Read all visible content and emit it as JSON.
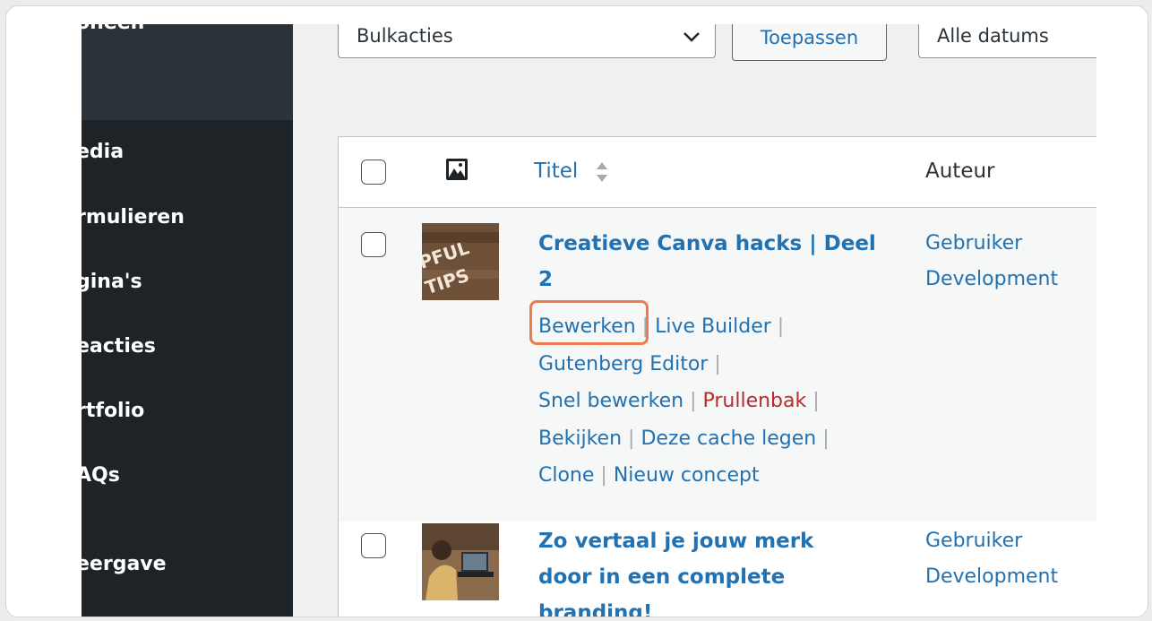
{
  "sidebar": {
    "top_partial": "oneen",
    "items": [
      {
        "label": "edia"
      },
      {
        "label": "rmulieren"
      },
      {
        "label": "gina's"
      },
      {
        "label": "eacties"
      },
      {
        "label": "rtfolio"
      },
      {
        "label": "AQs"
      },
      {
        "label": "eergave"
      }
    ]
  },
  "toolbar": {
    "bulk_select": "Bulkacties",
    "apply_label": "Toepassen",
    "date_select": "Alle datums"
  },
  "table": {
    "headers": {
      "title": "Titel",
      "author": "Auteur"
    },
    "rows": [
      {
        "title_line1": "Creatieve Canva hacks | Deel",
        "title_line2": "2",
        "author_line1": "Gebruiker",
        "author_line2": "Development",
        "actions": {
          "edit": "Bewerken",
          "live_builder": "Live Builder",
          "gutenberg": "Gutenberg Editor",
          "quick_edit": "Snel bewerken",
          "trash": "Prullenbak",
          "view": "Bekijken",
          "clear_cache": "Deze cache legen",
          "clone": "Clone",
          "new_draft": "Nieuw concept"
        },
        "sep": "|"
      },
      {
        "title_line1": "Zo vertaal je jouw merk",
        "title_line2": "door in een complete",
        "title_line3": "branding!",
        "author_line1": "Gebruiker",
        "author_line2": "Development"
      }
    ]
  },
  "thumb1_text": "PFUL TIPS",
  "colors": {
    "link": "#2271b1",
    "trash": "#b32d2e",
    "highlight": "#ef7a4e",
    "sidebar": "#1d2327"
  }
}
